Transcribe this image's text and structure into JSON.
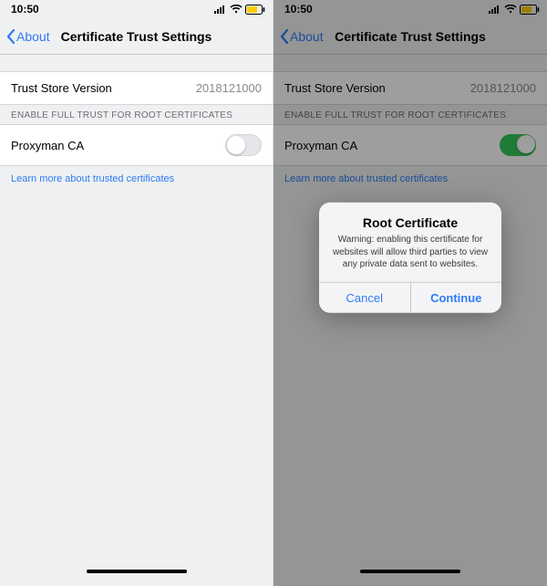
{
  "status": {
    "time": "10:50"
  },
  "nav": {
    "back": "About",
    "title": "Certificate Trust Settings"
  },
  "trustStore": {
    "label": "Trust Store Version",
    "value": "2018121000"
  },
  "sectionHeader": "ENABLE FULL TRUST FOR ROOT CERTIFICATES",
  "cert": {
    "name": "Proxyman CA"
  },
  "link": "Learn more about trusted certificates",
  "alert": {
    "title": "Root Certificate",
    "message": "Warning: enabling this certificate for websites will allow third parties to view any private data sent to websites.",
    "cancel": "Cancel",
    "continue": "Continue"
  }
}
